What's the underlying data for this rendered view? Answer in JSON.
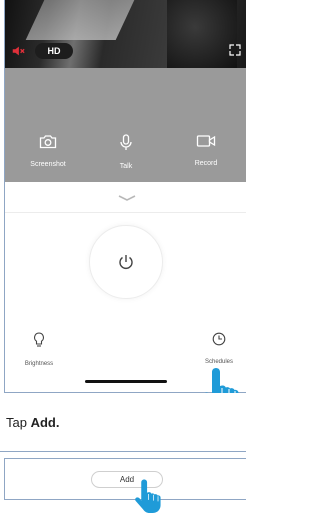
{
  "video": {
    "quality_label": "HD",
    "mute_icon": "speaker-muted-icon",
    "fullscreen_icon": "expand-icon",
    "mute_color": "#e0303a"
  },
  "controls": [
    {
      "label": "Screenshot",
      "icon": "camera-icon"
    },
    {
      "label": "Talk",
      "icon": "microphone-icon"
    },
    {
      "label": "Record",
      "icon": "video-record-icon"
    }
  ],
  "settings": {
    "brightness_label": "Brightness",
    "brightness_icon": "lightbulb-icon",
    "schedules_label": "Schedules",
    "schedules_icon": "clock-icon",
    "power_icon": "power-icon"
  },
  "instruction": {
    "prefix": "Tap ",
    "bold": "Add."
  },
  "add_button": {
    "label": "Add"
  },
  "colors": {
    "panel_gray": "#9a9a9a",
    "hand_blue": "#1f9bd8",
    "frame_border": "#8fa6c4"
  }
}
